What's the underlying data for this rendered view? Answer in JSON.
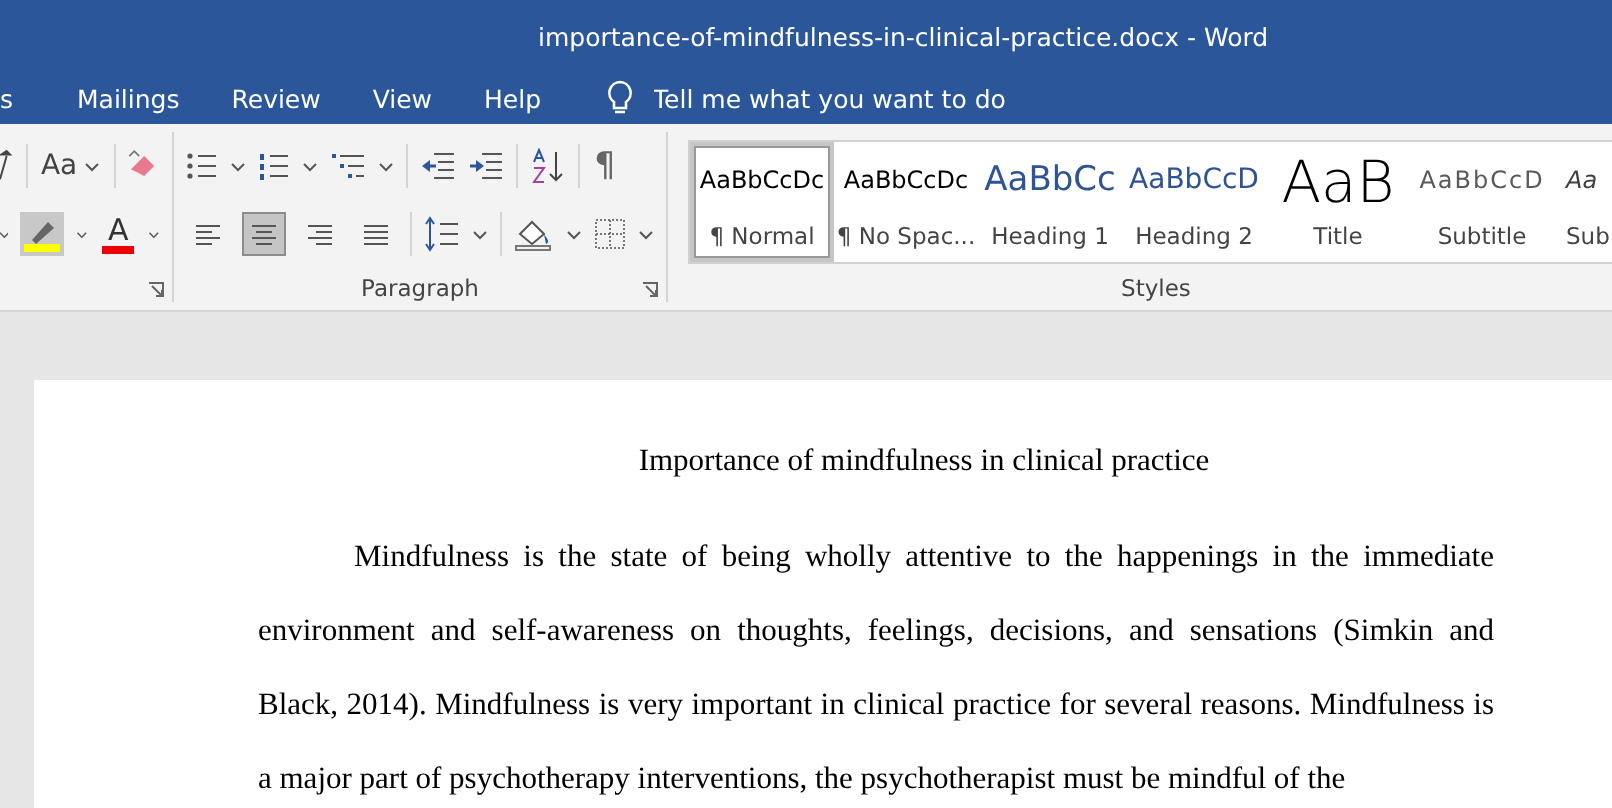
{
  "window": {
    "title": "importance-of-mindfulness-in-clinical-practice.docx  -  Word"
  },
  "tabs": [
    {
      "label": "s",
      "selected": false
    },
    {
      "label": "Mailings",
      "selected": false
    },
    {
      "label": "Review",
      "selected": false
    },
    {
      "label": "View",
      "selected": false
    },
    {
      "label": "Help",
      "selected": false
    }
  ],
  "tell_me": {
    "placeholder": "Tell me what you want to do"
  },
  "font_group": {
    "change_case": "Aa",
    "font_color": "A"
  },
  "paragraph_group": {
    "label": "Paragraph",
    "show_marks": "¶",
    "alignments": [
      {
        "kind": "left",
        "selected": false
      },
      {
        "kind": "center",
        "selected": true
      },
      {
        "kind": "right",
        "selected": false
      },
      {
        "kind": "justify",
        "selected": false
      }
    ]
  },
  "styles_group": {
    "label": "Styles",
    "styles": [
      {
        "preview": "AaBbCcDc",
        "name": "¶ Normal",
        "kind": "normal",
        "selected": true
      },
      {
        "preview": "AaBbCcDc",
        "name": "¶ No Spac...",
        "kind": "normal",
        "selected": false
      },
      {
        "preview": "AaBbCc",
        "name": "Heading 1",
        "kind": "heading1",
        "selected": false
      },
      {
        "preview": "AaBbCcD",
        "name": "Heading 2",
        "kind": "heading2",
        "selected": false
      },
      {
        "preview": "AaB",
        "name": "Title",
        "kind": "title",
        "selected": false
      },
      {
        "preview": "AaBbCcD",
        "name": "Subtitle",
        "kind": "subtitle",
        "selected": false
      },
      {
        "preview": "Aa",
        "name": "Sub",
        "kind": "subtle",
        "selected": false
      }
    ]
  },
  "document": {
    "title": "Importance of mindfulness in clinical practice",
    "paragraph": "Mindfulness is the state of being wholly attentive to the happenings in the immediate environment and self-awareness on thoughts, feelings, decisions, and sensations (Simkin and Black, 2014). Mindfulness is very important in clinical practice for several reasons. Mindfulness is a major part of psychotherapy interventions, the psychotherapist must be mindful of the"
  }
}
